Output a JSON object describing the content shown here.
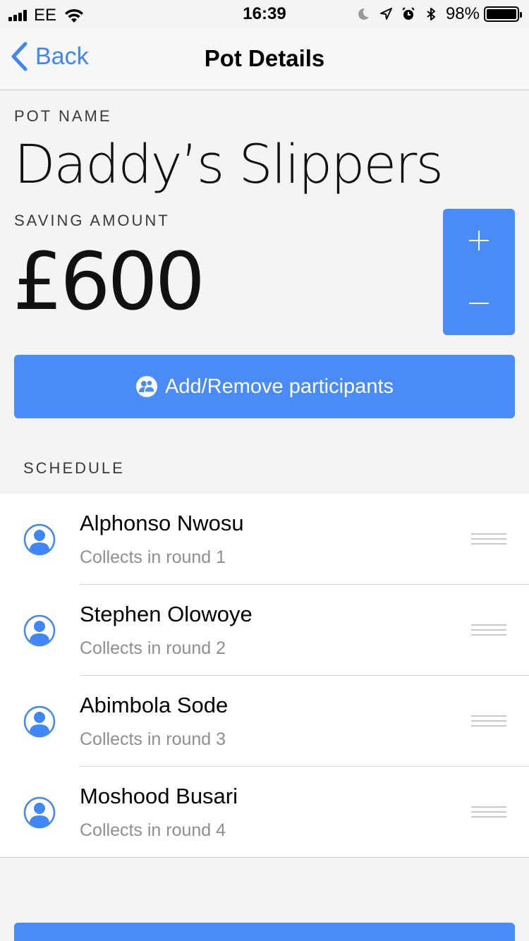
{
  "status_bar": {
    "carrier": "EE",
    "time": "16:39",
    "battery": "98%",
    "icons": [
      "signal-icon",
      "wifi-icon",
      "moon-icon",
      "location-icon",
      "alarm-icon",
      "bluetooth-icon",
      "battery-icon"
    ]
  },
  "nav": {
    "back_label": "Back",
    "title": "Pot Details"
  },
  "pot": {
    "name_label": "POT NAME",
    "name": "Daddy’s Slippers",
    "amount_label": "SAVING AMOUNT",
    "amount": "£600"
  },
  "stepper": {
    "increment_icon": "plus-icon",
    "decrement_icon": "minus-icon"
  },
  "participants_button": {
    "label": "Add/Remove participants",
    "icon": "participants-icon"
  },
  "schedule": {
    "label": "SCHEDULE",
    "items": [
      {
        "name": "Alphonso Nwosu",
        "subtitle": "Collects in round 1"
      },
      {
        "name": "Stephen Olowoye",
        "subtitle": "Collects in round 2"
      },
      {
        "name": "Abimbola Sode",
        "subtitle": "Collects in round 3"
      },
      {
        "name": "Moshood Busari",
        "subtitle": "Collects in round 4"
      }
    ]
  },
  "colors": {
    "accent": "#4a8cf7",
    "link": "#3f87f5",
    "secondary_text": "#8e8e93",
    "background": "#f4f4f4"
  }
}
